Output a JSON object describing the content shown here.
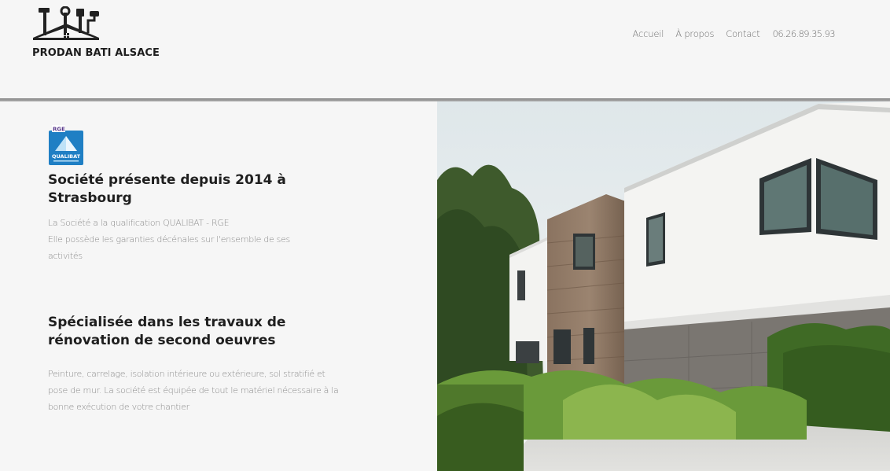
{
  "brand": {
    "name": "PRODAN BATI ALSACE"
  },
  "nav": {
    "items": [
      "Accueil",
      "À propos",
      "Contact"
    ],
    "phone": "06.26.89.35.93"
  },
  "badge": {
    "top_label": "RGE",
    "label": "QUALIBAT",
    "icon": "qualibat-rge-logo"
  },
  "sections": [
    {
      "title": "Société présente depuis 2014 à Strasbourg",
      "lines": [
        "La Société a la qualification QUALIBAT - RGE",
        "Elle possède les garanties décénales sur l'ensemble de ses activités"
      ]
    },
    {
      "title": "Spécialisée dans les travaux de rénovation de second oeuvres",
      "text": "Peinture, carrelage, isolation intérieure ou extérieure, sol stratifié et pose de mur. La société est équipée de tout le matériel nécessaire à la bonne exécution de votre chantier"
    }
  ],
  "colors": {
    "background": "#f6f6f6",
    "divider": "#8a8a8a",
    "badge_blue": "#1f7fc4",
    "heading": "#1f1f1f",
    "text": "#8a8a8a"
  }
}
